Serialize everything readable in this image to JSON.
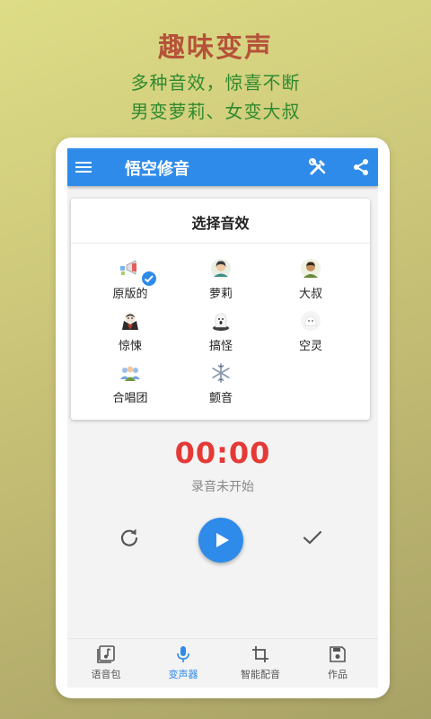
{
  "promo": {
    "title": "趣味变声",
    "line1": "多种音效，惊喜不断",
    "line2": "男变萝莉、女变大叔"
  },
  "app": {
    "title": "悟空修音",
    "accent": "#2f8bea",
    "timer_color": "#e53935"
  },
  "effects": {
    "title": "选择音效",
    "items": [
      {
        "label": "原版的",
        "icon": "megaphone-icon",
        "selected": true
      },
      {
        "label": "萝莉",
        "icon": "girl-avatar-icon"
      },
      {
        "label": "大叔",
        "icon": "man-avatar-icon"
      },
      {
        "label": "惊悚",
        "icon": "vampire-icon"
      },
      {
        "label": "搞怪",
        "icon": "ghost-icon"
      },
      {
        "label": "空灵",
        "icon": "spirit-icon"
      },
      {
        "label": "合唱团",
        "icon": "group-icon"
      },
      {
        "label": "颤音",
        "icon": "snowflake-icon"
      }
    ]
  },
  "recorder": {
    "time": "00:00",
    "status": "录音未开始"
  },
  "nav": {
    "items": [
      {
        "label": "语音包",
        "icon": "music-note-icon"
      },
      {
        "label": "变声器",
        "icon": "microphone-icon",
        "active": true
      },
      {
        "label": "智能配音",
        "icon": "crop-icon"
      },
      {
        "label": "作品",
        "icon": "save-icon"
      }
    ]
  }
}
